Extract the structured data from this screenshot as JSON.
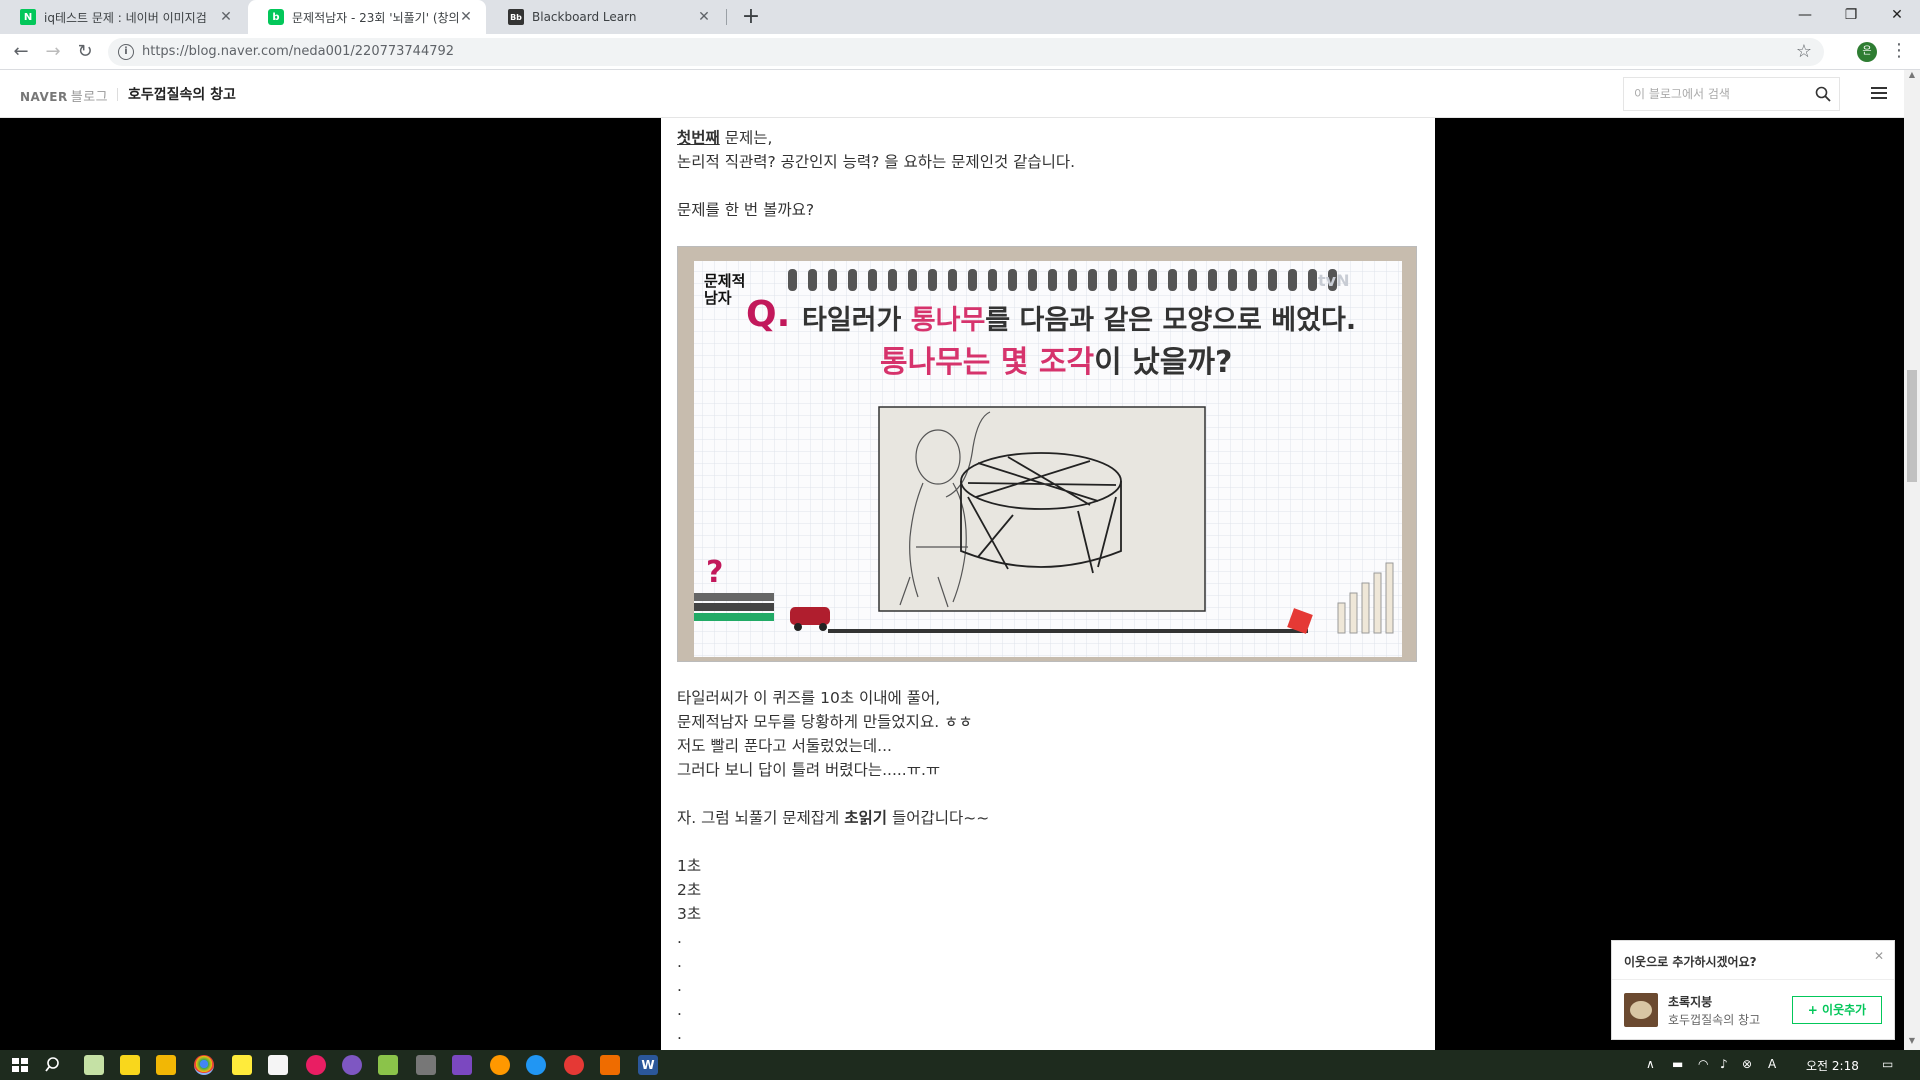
{
  "browser": {
    "tabs": [
      {
        "title": "iq테스트 문제 : 네이버 이미지검",
        "favicon": "naver-n-icon",
        "active": false
      },
      {
        "title": "문제적남자 - 23회 '뇌풀기' (창의",
        "favicon": "naver-blog-icon",
        "active": true
      },
      {
        "title": "Blackboard Learn",
        "favicon": "blackboard-icon",
        "active": false
      }
    ],
    "url": "https://blog.naver.com/neda001/220773744792",
    "profile_initial": "은"
  },
  "blog_header": {
    "logo": "NAVER",
    "logo_sub": "블로그",
    "blog_title": "호두껍질속의 창고",
    "search_placeholder": "이 블로그에서 검색"
  },
  "post": {
    "line1_bold": "첫번째",
    "line1_rest": " 문제는,",
    "line2": "논리적 직관력? 공간인지 능력? 을 요하는 문제인것 같습니다.",
    "line3": "문제를 한 번 볼까요?",
    "image": {
      "show_logo": "문제적 남자",
      "channel": "tvN",
      "q_mark": "Q.",
      "question_line1_pre": "타일러가 ",
      "question_line1_hl": "통나무",
      "question_line1_post": "를 다음과 같은 모양으로 베었다.",
      "question_line2_hl": "통나무는 몇 조각",
      "question_line2_post": "이 났을까?"
    },
    "para2": [
      "타일러씨가 이 퀴즈를 10초 이내에 풀어,",
      "문제적남자 모두를 당황하게 만들었지요. ㅎㅎ",
      "저도 빨리 푼다고 서둘렀었는데...",
      "그러다 보니 답이 틀려 버렸다는.....ㅠ.ㅠ"
    ],
    "line_count_pre": "자. 그럼 뇌풀기 문제잡게 ",
    "line_count_bold": "초읽기",
    "line_count_post": " 들어갑니다~~",
    "countdown": [
      "1초",
      "2초",
      "3초",
      ".",
      ".",
      ".",
      ".",
      "."
    ]
  },
  "popup": {
    "question": "이웃으로 추가하시겠어요?",
    "name": "초록지붕",
    "blog": "호두껍질속의 창고",
    "add_label": "+ 이웃추가"
  },
  "taskbar": {
    "time": "오전 2:18",
    "ime": "A"
  },
  "colors": {
    "naver_green": "#03c75a",
    "highlight_pink": "#d6336c",
    "taskbar_bg": "#1e2b1e"
  }
}
